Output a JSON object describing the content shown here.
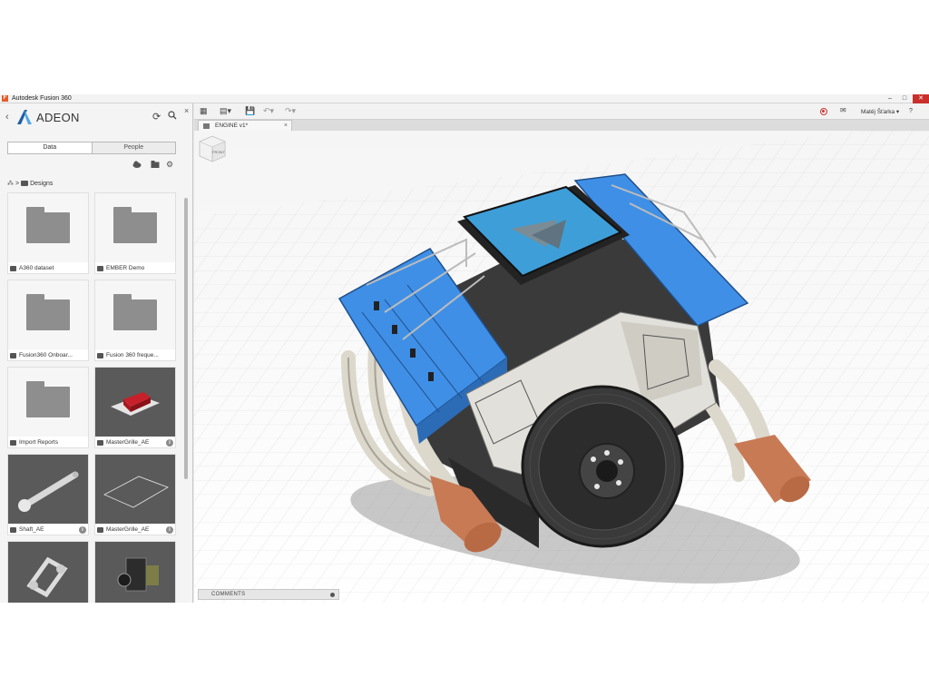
{
  "window": {
    "title": "Autodesk Fusion 360"
  },
  "panel": {
    "team_name": "ADEON",
    "tabs": [
      {
        "label": "Data",
        "active": true
      },
      {
        "label": "People",
        "active": false
      }
    ],
    "breadcrumb": "Designs",
    "items": [
      {
        "name": "A360 dataset",
        "kind": "folder"
      },
      {
        "name": "EMBER Demo",
        "kind": "folder"
      },
      {
        "name": "Fusion360 Onboar...",
        "kind": "folder"
      },
      {
        "name": "Fusion 360 freque...",
        "kind": "folder"
      },
      {
        "name": "Import Reports",
        "kind": "folder"
      },
      {
        "name": "MasterGrille_AE",
        "kind": "design"
      },
      {
        "name": "Shaft_AE",
        "kind": "design"
      },
      {
        "name": "MasterGrille_AE",
        "kind": "design"
      },
      {
        "name": "",
        "kind": "design"
      },
      {
        "name": "",
        "kind": "design"
      }
    ]
  },
  "toolbar": {
    "user_name": "Matěj Šťarka ▾",
    "help": "?"
  },
  "document": {
    "tab_label": "ENGINE v1*"
  },
  "viewcube": {
    "face": "FRONT"
  },
  "comments": {
    "label": "COMMENTS"
  },
  "colors": {
    "accent_blue": "#3f8fe6",
    "exhaust": "#c87a55",
    "block": "#3a3a3a",
    "alloy": "#e2e0da"
  }
}
